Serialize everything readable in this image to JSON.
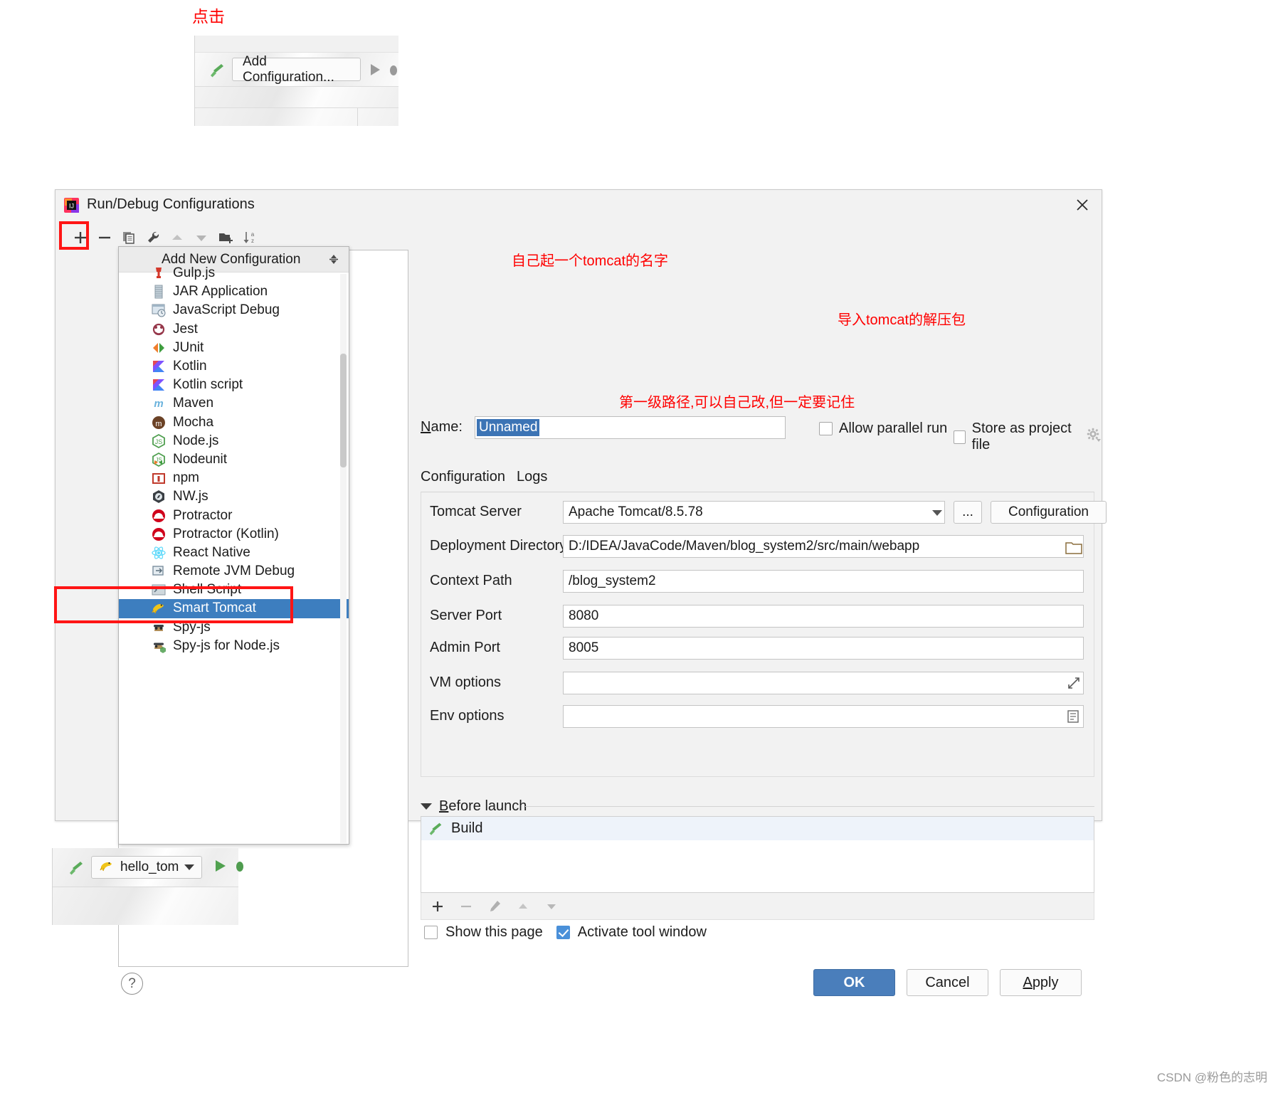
{
  "annotations": {
    "click_top": "点击",
    "name_hint": "自己起一个tomcat的名字",
    "tomcat_hint": "导入tomcat的解压包",
    "context_hint": "第一级路径,可以自己改,但一定要记住"
  },
  "top_widget": {
    "add_configuration_label": "Add Configuration..."
  },
  "dialog": {
    "title": "Run/Debug Configurations",
    "toolbar": [
      {
        "name": "add",
        "glyph": "+"
      },
      {
        "name": "remove",
        "glyph": "−"
      },
      {
        "name": "copy",
        "glyph": "copy-icon"
      },
      {
        "name": "edit-templates",
        "glyph": "wrench-icon"
      },
      {
        "name": "move-up",
        "glyph": "up-icon"
      },
      {
        "name": "move-down",
        "glyph": "down-icon"
      },
      {
        "name": "new-folder",
        "glyph": "folder-add-icon"
      },
      {
        "name": "sort",
        "glyph": "sort-az-icon"
      }
    ],
    "popup": {
      "header": "Add New Configuration",
      "items": [
        {
          "label": "Gulp.js",
          "icon": "gulp-icon"
        },
        {
          "label": "JAR Application",
          "icon": "jar-icon"
        },
        {
          "label": "JavaScript Debug",
          "icon": "js-debug-icon"
        },
        {
          "label": "Jest",
          "icon": "jest-icon"
        },
        {
          "label": "JUnit",
          "icon": "junit-icon"
        },
        {
          "label": "Kotlin",
          "icon": "kotlin-icon"
        },
        {
          "label": "Kotlin script",
          "icon": "kotlin-icon"
        },
        {
          "label": "Maven",
          "icon": "maven-icon"
        },
        {
          "label": "Mocha",
          "icon": "mocha-icon"
        },
        {
          "label": "Node.js",
          "icon": "nodejs-icon"
        },
        {
          "label": "Nodeunit",
          "icon": "nodeunit-icon"
        },
        {
          "label": "npm",
          "icon": "npm-icon"
        },
        {
          "label": "NW.js",
          "icon": "nwjs-icon"
        },
        {
          "label": "Protractor",
          "icon": "protractor-icon"
        },
        {
          "label": "Protractor (Kotlin)",
          "icon": "protractor-icon"
        },
        {
          "label": "React Native",
          "icon": "react-icon"
        },
        {
          "label": "Remote JVM Debug",
          "icon": "remote-debug-icon"
        },
        {
          "label": "Shell Script",
          "icon": "shell-icon"
        },
        {
          "label": "Smart Tomcat",
          "icon": "tomcat-icon",
          "selected": true
        },
        {
          "label": "Spy-js",
          "icon": "spyjs-icon"
        },
        {
          "label": "Spy-js for Node.js",
          "icon": "spyjs-node-icon"
        }
      ]
    },
    "name_label": "Name:",
    "name_value": "Unnamed",
    "allow_parallel_run": {
      "label": "Allow parallel run",
      "checked": false
    },
    "store_as_project_file": {
      "label": "Store as project file",
      "checked": false
    },
    "tabs": [
      {
        "label": "Configuration",
        "active": true
      },
      {
        "label": "Logs",
        "active": false
      }
    ],
    "fields": {
      "tomcat_server": {
        "label": "Tomcat Server",
        "value": "Apache Tomcat/8.5.78"
      },
      "deployment_directory": {
        "label": "Deployment Directory",
        "value": "D:/IDEA/JavaCode/Maven/blog_system2/src/main/webapp"
      },
      "context_path": {
        "label": "Context Path",
        "value": "/blog_system2"
      },
      "server_port": {
        "label": "Server Port",
        "value": "8080"
      },
      "admin_port": {
        "label": "Admin Port",
        "value": "8005"
      },
      "vm_options": {
        "label": "VM options",
        "value": ""
      },
      "env_options": {
        "label": "Env options",
        "value": ""
      }
    },
    "buttons": {
      "browse_ellipsis": "...",
      "configuration": "Configuration",
      "ok": "OK",
      "cancel": "Cancel",
      "apply": "Apply",
      "help": "?"
    },
    "before_launch": {
      "title": "Before launch",
      "items": [
        {
          "label": "Build",
          "icon": "hammer-icon"
        }
      ],
      "toolbar": [
        {
          "name": "add",
          "glyph": "+"
        },
        {
          "name": "remove",
          "glyph": "−"
        },
        {
          "name": "edit",
          "glyph": "pencil-icon"
        },
        {
          "name": "up",
          "glyph": "up-icon"
        },
        {
          "name": "down",
          "glyph": "down-icon"
        }
      ]
    },
    "show_this_page": {
      "label": "Show this page",
      "checked": false
    },
    "activate_tool_window": {
      "label": "Activate tool window",
      "checked": true
    }
  },
  "bottom_widget": {
    "run_config_name": "hello_tom"
  },
  "watermark": "CSDN @粉色的志明",
  "colors": {
    "accent_blue": "#4a7ebb",
    "selection_blue": "#3d7ebf",
    "annotation_red": "#ff0000",
    "tab_underline": "#4585d6",
    "checkbox_blue": "#4a90d9"
  }
}
